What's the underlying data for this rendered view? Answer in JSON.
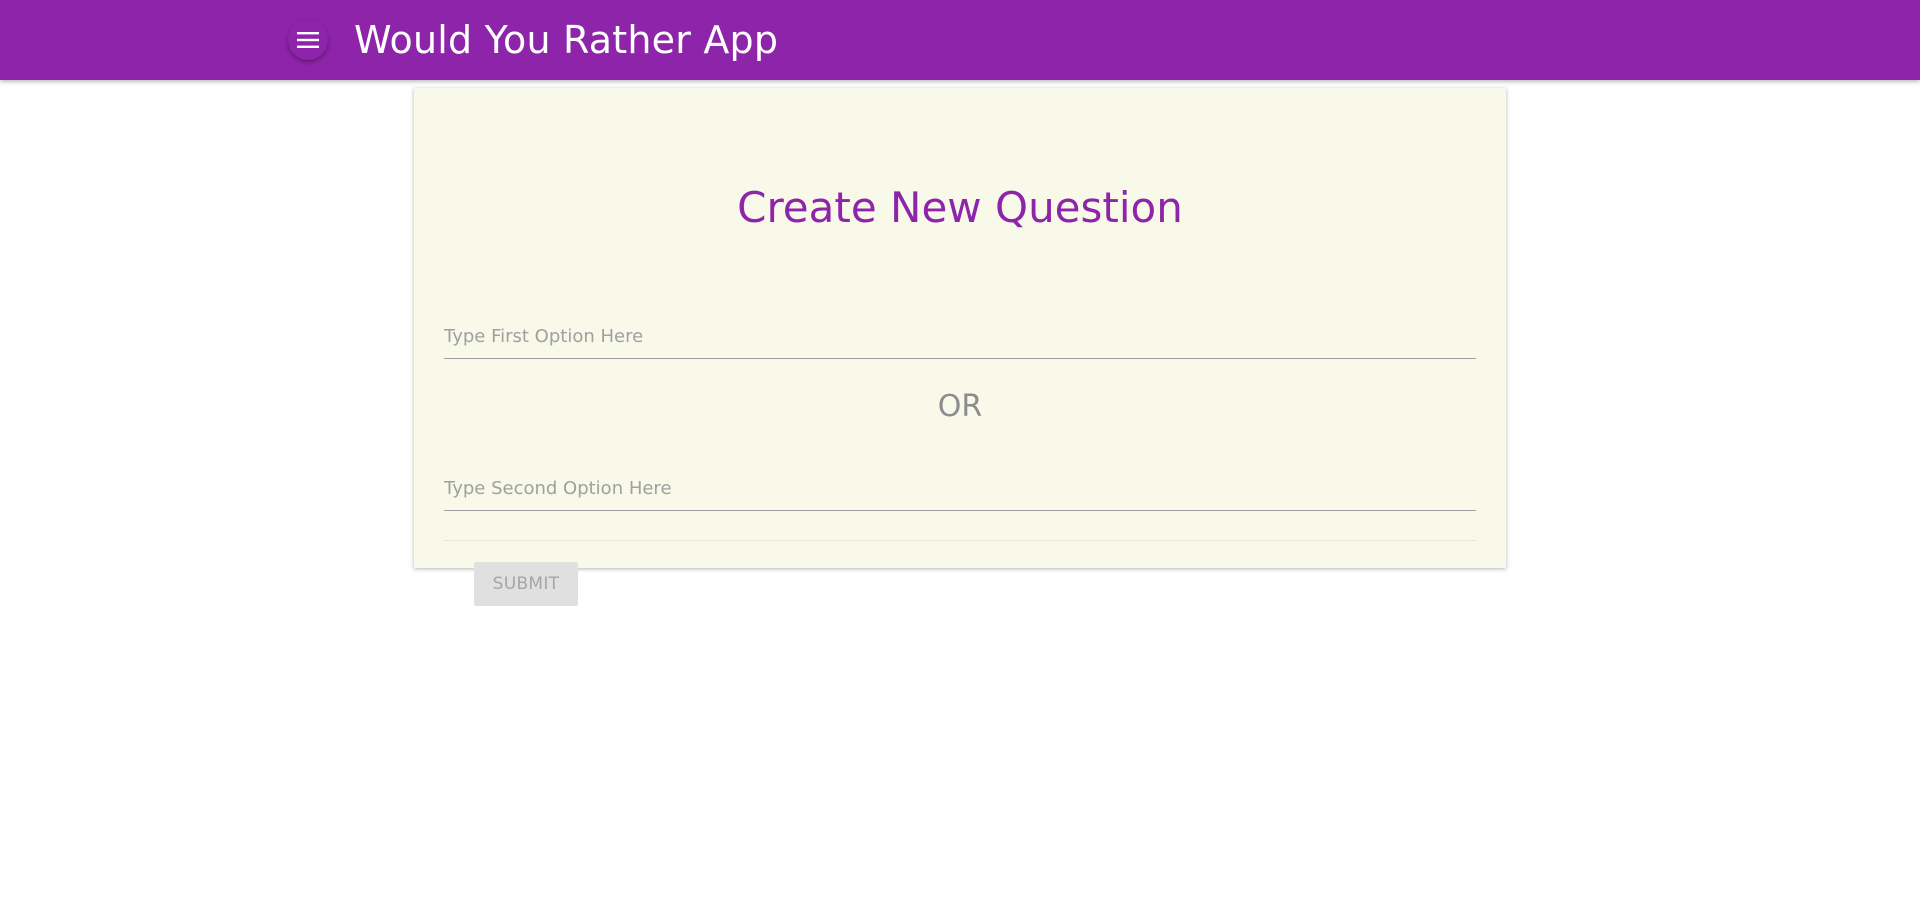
{
  "header": {
    "title": "Would You Rather App",
    "menu_icon": "hamburger-menu-icon",
    "bg_color": "#8e24aa"
  },
  "form": {
    "title": "Create New Question",
    "option_one": {
      "value": "",
      "placeholder": "Type First Option Here"
    },
    "separator": "OR",
    "option_two": {
      "value": "",
      "placeholder": "Type Second Option Here"
    },
    "submit_label": "SUBMIT",
    "submit_disabled": true,
    "card_bg_color": "#f8f9e8",
    "title_color": "#8e24aa"
  }
}
